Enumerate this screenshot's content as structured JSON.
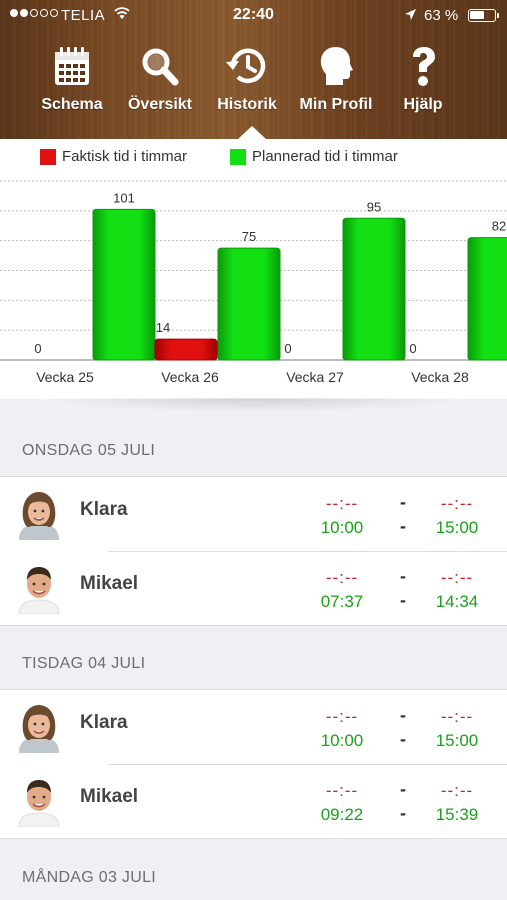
{
  "status_bar": {
    "carrier": "TELIA",
    "time": "22:40",
    "battery": "63 %",
    "battery_level": 0.63
  },
  "tabs": [
    {
      "label": "Schema",
      "icon": "calendar-icon"
    },
    {
      "label": "Översikt",
      "icon": "magnifier-icon"
    },
    {
      "label": "Historik",
      "icon": "history-clock-icon",
      "selected": true
    },
    {
      "label": "Min Profil",
      "icon": "head-profile-icon"
    },
    {
      "label": "Hjälp",
      "icon": "question-mark-icon"
    }
  ],
  "legend": {
    "actual": "Faktisk tid i timmar",
    "planned": "Plannerad tid i timmar"
  },
  "colors": {
    "actual": "#e01010",
    "planned": "#12e012",
    "planned_dark": "#0a9a0a",
    "actual_dark": "#a00000"
  },
  "chart_data": {
    "type": "bar",
    "categories": [
      "Vecka 25",
      "Vecka 26",
      "Vecka 27",
      "Vecka 28"
    ],
    "series": [
      {
        "name": "Faktisk tid i timmar",
        "values": [
          0,
          14,
          0,
          0
        ]
      },
      {
        "name": "Plannerad tid i timmar",
        "values": [
          101,
          75,
          95,
          82
        ]
      }
    ],
    "ylim": [
      0,
      120
    ],
    "grid": true,
    "legend": "top"
  },
  "days": [
    {
      "title": "ONSDAG 05 JULI",
      "entries": [
        {
          "name": "Klara",
          "actual_start": "--:--",
          "actual_end": "--:--",
          "planned_start": "10:00",
          "planned_end": "15:00",
          "avatar": "girl"
        },
        {
          "name": "Mikael",
          "actual_start": "--:--",
          "actual_end": "--:--",
          "planned_start": "07:37",
          "planned_end": "14:34",
          "avatar": "boy"
        }
      ]
    },
    {
      "title": "TISDAG 04 JULI",
      "entries": [
        {
          "name": "Klara",
          "actual_start": "--:--",
          "actual_end": "--:--",
          "planned_start": "10:00",
          "planned_end": "15:00",
          "avatar": "girl"
        },
        {
          "name": "Mikael",
          "actual_start": "--:--",
          "actual_end": "--:--",
          "planned_start": "09:22",
          "planned_end": "15:39",
          "avatar": "boy"
        }
      ]
    },
    {
      "title": "MÅNDAG 03 JULI",
      "entries": []
    }
  ],
  "separator": "-"
}
